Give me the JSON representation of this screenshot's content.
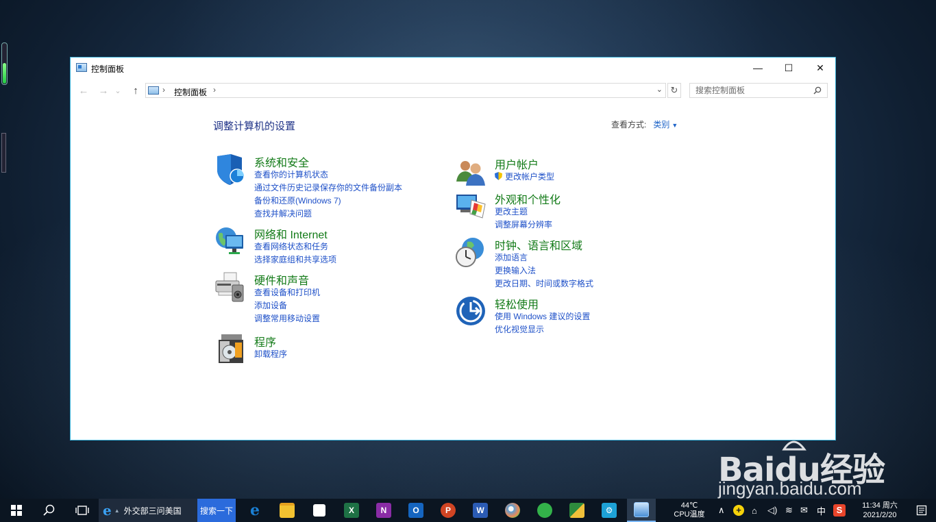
{
  "window": {
    "title": "控制面板",
    "minimize_glyph": "—",
    "maximize_glyph": "☐",
    "close_glyph": "✕"
  },
  "nav": {
    "back_glyph": "←",
    "forward_glyph": "→",
    "recent_glyph": "⌄",
    "up_glyph": "↑",
    "breadcrumb": [
      "控制面板"
    ],
    "refresh_glyph": "↻",
    "search_placeholder": "搜索控制面板"
  },
  "main": {
    "heading": "调整计算机的设置",
    "view_by_label": "查看方式:",
    "view_by_value": "类别"
  },
  "categories_left": [
    {
      "title": "系统和安全",
      "icon": "shield-icon",
      "links": [
        "查看你的计算机状态",
        "通过文件历史记录保存你的文件备份副本",
        "备份和还原(Windows 7)",
        "查找并解决问题"
      ]
    },
    {
      "title": "网络和 Internet",
      "icon": "network-icon",
      "links": [
        "查看网络状态和任务",
        "选择家庭组和共享选项"
      ]
    },
    {
      "title": "硬件和声音",
      "icon": "printer-icon",
      "links": [
        "查看设备和打印机",
        "添加设备",
        "调整常用移动设置"
      ]
    },
    {
      "title": "程序",
      "icon": "programs-icon",
      "links": [
        "卸载程序"
      ]
    }
  ],
  "categories_right": [
    {
      "title": "用户帐户",
      "icon": "users-icon",
      "links": [
        "更改帐户类型"
      ]
    },
    {
      "title": "外观和个性化",
      "icon": "appearance-icon",
      "links": [
        "更改主题",
        "调整屏幕分辨率"
      ]
    },
    {
      "title": "时钟、语言和区域",
      "icon": "clock-globe-icon",
      "links": [
        "添加语言",
        "更换输入法",
        "更改日期、时间或数字格式"
      ]
    },
    {
      "title": "轻松使用",
      "icon": "ease-of-access-icon",
      "links": [
        "使用 Windows 建议的设置",
        "优化视觉显示"
      ]
    }
  ],
  "taskbar": {
    "ie_text": "外交部三问美国",
    "search_button": "搜索一下",
    "temperature": "44℃",
    "cpu_label": "CPU温度",
    "ime": "中",
    "time": "11:34 周六",
    "date": "2021/2/20",
    "apps": [
      {
        "name": "edge",
        "letter": "e",
        "color": "#1a7fd4"
      },
      {
        "name": "explorer",
        "letter": "",
        "color": "#f2c231"
      },
      {
        "name": "store",
        "letter": "",
        "color": "#ffffff"
      },
      {
        "name": "excel",
        "letter": "X",
        "color": "#1e7145"
      },
      {
        "name": "onenote",
        "letter": "N",
        "color": "#8a2ca6"
      },
      {
        "name": "outlook",
        "letter": "O",
        "color": "#1565c0"
      },
      {
        "name": "powerpoint",
        "letter": "P",
        "color": "#d04423"
      },
      {
        "name": "word",
        "letter": "W",
        "color": "#2b5bb4"
      },
      {
        "name": "paint",
        "letter": "",
        "color": "#5a9fd6"
      },
      {
        "name": "360",
        "letter": "",
        "color": "#33b24a"
      },
      {
        "name": "project",
        "letter": "",
        "color": "#2e8b3d"
      },
      {
        "name": "settings",
        "letter": "⚙",
        "color": "#1da1d6"
      },
      {
        "name": "control-panel",
        "letter": "",
        "color": "#4a8fd6"
      }
    ]
  },
  "watermark": {
    "brand": "Baidu经验",
    "url": "jingyan.baidu.com"
  }
}
